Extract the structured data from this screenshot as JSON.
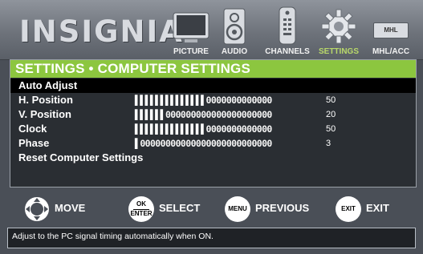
{
  "brand": {
    "logo_text": "INSIGNIA"
  },
  "tabs": [
    {
      "label": "PICTURE",
      "icon": "tv-icon",
      "active": false
    },
    {
      "label": "AUDIO",
      "icon": "speaker-icon",
      "active": false
    },
    {
      "label": "CHANNELS",
      "icon": "remote-icon",
      "active": false
    },
    {
      "label": "SETTINGS",
      "icon": "gear-icon",
      "active": true
    },
    {
      "label": "MHL/ACC",
      "icon": "mhl-icon",
      "badge": "MHL",
      "active": false
    }
  ],
  "menu": {
    "title": "SETTINGS • COMPUTER SETTINGS",
    "items": [
      {
        "label": "Auto Adjust",
        "selected": true
      },
      {
        "label": "H. Position",
        "value": "50",
        "filled": 14,
        "total": 27
      },
      {
        "label": "V. Position",
        "value": "20",
        "filled": 6,
        "total": 27
      },
      {
        "label": "Clock",
        "value": "50",
        "filled": 14,
        "total": 27
      },
      {
        "label": "Phase",
        "value": "3",
        "filled": 1,
        "total": 27
      },
      {
        "label": "Reset Computer Settings"
      }
    ]
  },
  "footer": {
    "move": {
      "label": "MOVE"
    },
    "select": {
      "label": "SELECT",
      "key_top": "OK",
      "key_bottom": "ENTER"
    },
    "previous": {
      "label": "PREVIOUS",
      "key": "MENU"
    },
    "exit": {
      "label": "EXIT",
      "key": "EXIT"
    }
  },
  "help_text": "Adjust to the PC signal timing automatically when ON.",
  "colors": {
    "accent": "#8cc63f",
    "panel": "#2a2e33",
    "selected_row": "#000000"
  }
}
